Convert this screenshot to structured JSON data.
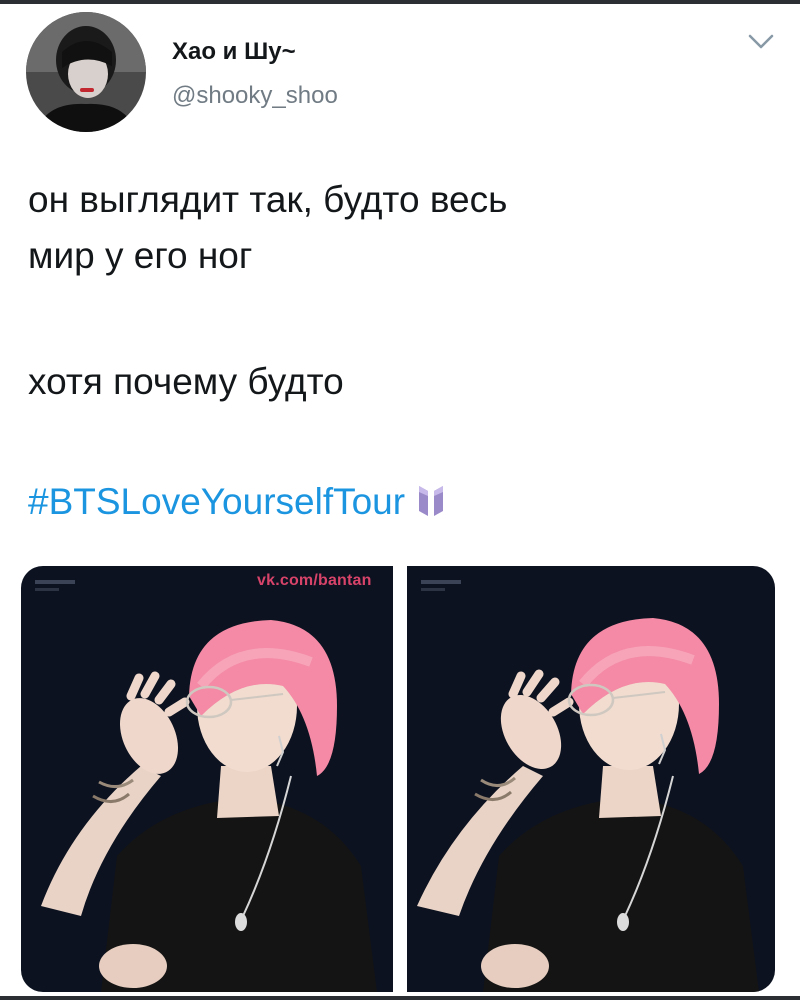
{
  "tweet": {
    "author": {
      "display_name": "Хао и Шу~",
      "handle": "@shooky_shoo",
      "avatar_icon": "user-avatar"
    },
    "menu_icon": "chevron-down-icon",
    "text_lines": [
      "он выглядит так, будто весь",
      "мир у его ног",
      "хотя почему будто"
    ],
    "hashtag": "#BTSLoveYourselfTour",
    "hashflag_icon": "bts-logo-icon",
    "media": {
      "photos": [
        {
          "label": "photo-left",
          "watermark": "vk.com/bantan"
        },
        {
          "label": "photo-right"
        }
      ]
    }
  },
  "colors": {
    "link": "#1b95e0",
    "text": "#14171a",
    "secondary": "#707b84",
    "hair_pink": "#f48aa5",
    "photo_bg": "#0c1220"
  }
}
